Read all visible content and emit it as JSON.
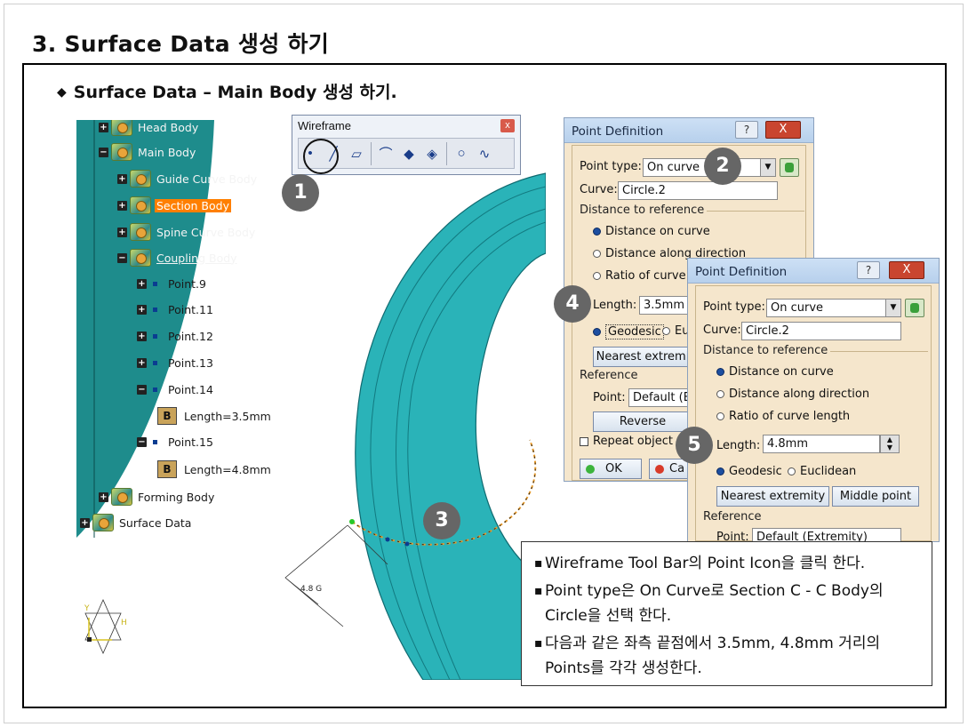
{
  "page": {
    "title": "3. Surface Data 생성 하기",
    "subtitle": "Surface Data – Main Body 생성 하기."
  },
  "spec_tree": {
    "items": [
      {
        "label": "Head Body",
        "type": "body"
      },
      {
        "label": "Main Body",
        "type": "body"
      },
      {
        "label": "Guide Curve Body",
        "type": "body"
      },
      {
        "label": "Section Body",
        "type": "body",
        "selected": true
      },
      {
        "label": "Spine Curve Body",
        "type": "body"
      },
      {
        "label": "Coupling Body",
        "type": "body"
      },
      {
        "label": "Point.9",
        "type": "point"
      },
      {
        "label": "Point.11",
        "type": "point"
      },
      {
        "label": "Point.12",
        "type": "point"
      },
      {
        "label": "Point.13",
        "type": "point"
      },
      {
        "label": "Point.14",
        "type": "point"
      },
      {
        "label": "Length=3.5mm",
        "type": "length"
      },
      {
        "label": "Point.15",
        "type": "point"
      },
      {
        "label": "Length=4.8mm",
        "type": "length"
      },
      {
        "label": "Forming Body",
        "type": "body"
      },
      {
        "label": "Surface Data",
        "type": "body"
      }
    ]
  },
  "viewport": {
    "dimension_label": "4.8 G",
    "axis_labels": {
      "y": "Y",
      "h": "H"
    }
  },
  "toolbar": {
    "title": "Wireframe",
    "close_label": "x",
    "icons": [
      "point-icon",
      "line-icon",
      "plane-icon",
      "projection-icon",
      "intersection-icon",
      "offset-icon",
      "circle-icon",
      "spline-icon"
    ]
  },
  "markers": [
    "1",
    "2",
    "3",
    "4",
    "5"
  ],
  "dialog1": {
    "title": "Point Definition",
    "help_label": "?",
    "close_label": "X",
    "point_type_label": "Point type:",
    "point_type_value": "On curve",
    "curve_label": "Curve:",
    "curve_value": "Circle.2",
    "distance_group": "Distance to reference",
    "radio_distance_on_curve": "Distance on curve",
    "radio_distance_along": "Distance along direction",
    "radio_ratio": "Ratio of curve",
    "length_label": "Length:",
    "length_value": "3.5mm",
    "geodesic": "Geodesic",
    "euclidean": "Eu",
    "nearest_extremity": "Nearest extremi",
    "reference_group": "Reference",
    "point_label": "Point:",
    "point_value": "Default (Ex",
    "reverse": "Reverse",
    "repeat_object": "Repeat object a",
    "ok": "OK",
    "cancel": "Ca"
  },
  "dialog2": {
    "title": "Point Definition",
    "help_label": "?",
    "close_label": "X",
    "point_type_label": "Point type:",
    "point_type_value": "On curve",
    "curve_label": "Curve:",
    "curve_value": "Circle.2",
    "distance_group": "Distance to reference",
    "radio_distance_on_curve": "Distance on curve",
    "radio_distance_along": "Distance along direction",
    "radio_ratio": "Ratio of curve length",
    "length_label": "Length:",
    "length_value": "4.8mm",
    "geodesic": "Geodesic",
    "euclidean": "Euclidean",
    "nearest_extremity": "Nearest extremity",
    "middle_point": "Middle point",
    "reference_group": "Reference",
    "point_label": "Point:",
    "point_value": "Default (Extremity)"
  },
  "notes": [
    "Wireframe Tool Bar의 Point Icon을 클릭 한다.",
    "Point type은 On Curve로 Section C - C Body의 Circle을 선택 한다.",
    "다음과 같은 좌측 끝점에서 3.5mm, 4.8mm 거리의 Points를 각각 생성한다."
  ],
  "colors": {
    "tree_teal": "#1e8c8c",
    "surface_teal": "#2ab3b8",
    "selection": "#ff7f00",
    "marker_gray": "#666666",
    "dialog_bg": "#f5e6cc"
  }
}
